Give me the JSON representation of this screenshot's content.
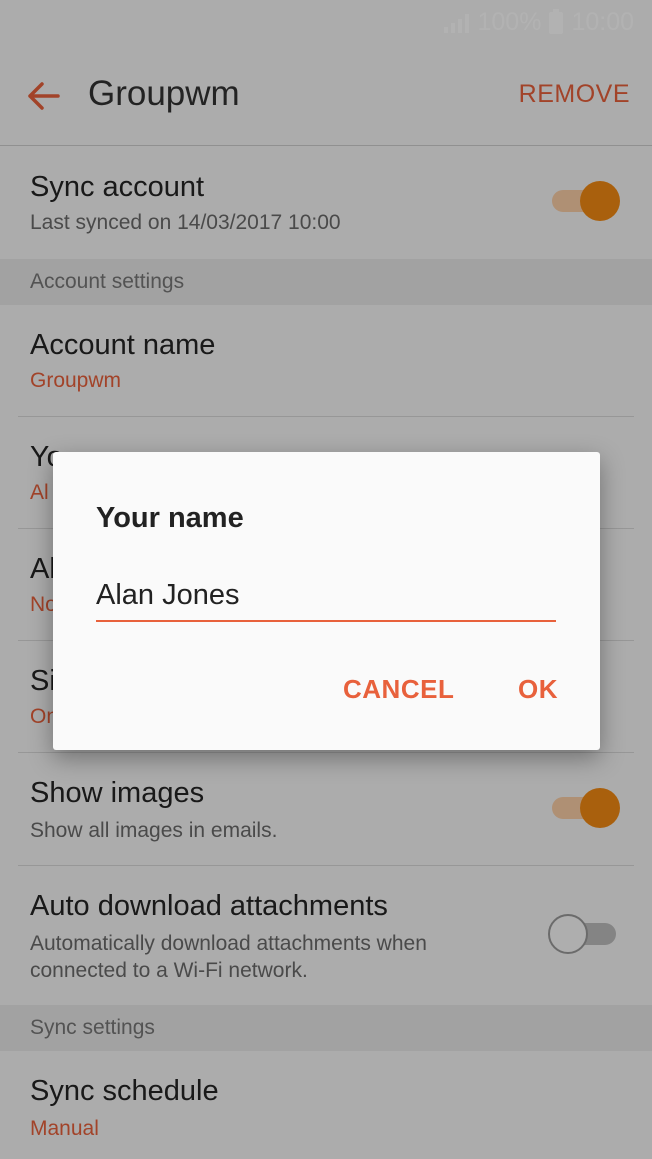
{
  "status": {
    "battery_text": "100%",
    "time": "10:00"
  },
  "appbar": {
    "title": "Groupwm",
    "remove_label": "REMOVE"
  },
  "sync_account": {
    "label": "Sync account",
    "sub": "Last synced on 14/03/2017  10:00",
    "enabled": true
  },
  "sections": {
    "account_settings": "Account settings",
    "sync_settings": "Sync settings"
  },
  "account_name": {
    "label": "Account name",
    "value": "Groupwm"
  },
  "hidden_rows": [
    {
      "label_fragment": "Yo",
      "value_fragment": "Al"
    },
    {
      "label_fragment": "Al",
      "value_fragment": "No"
    },
    {
      "label_fragment": "Si",
      "value_fragment": "On"
    }
  ],
  "show_images": {
    "label": "Show images",
    "sub": "Show all images in emails.",
    "enabled": true
  },
  "auto_download": {
    "label": "Auto download attachments",
    "sub_line1": "Automatically download attachments when",
    "sub_line2": "connected to a Wi-Fi network.",
    "enabled": false
  },
  "sync_schedule": {
    "label": "Sync schedule",
    "value": "Manual"
  },
  "dialog": {
    "title": "Your name",
    "input_value": "Alan Jones",
    "cancel_label": "CANCEL",
    "ok_label": "OK"
  },
  "colors": {
    "accent": "#e8613c",
    "switch_on": "#f38a13"
  }
}
